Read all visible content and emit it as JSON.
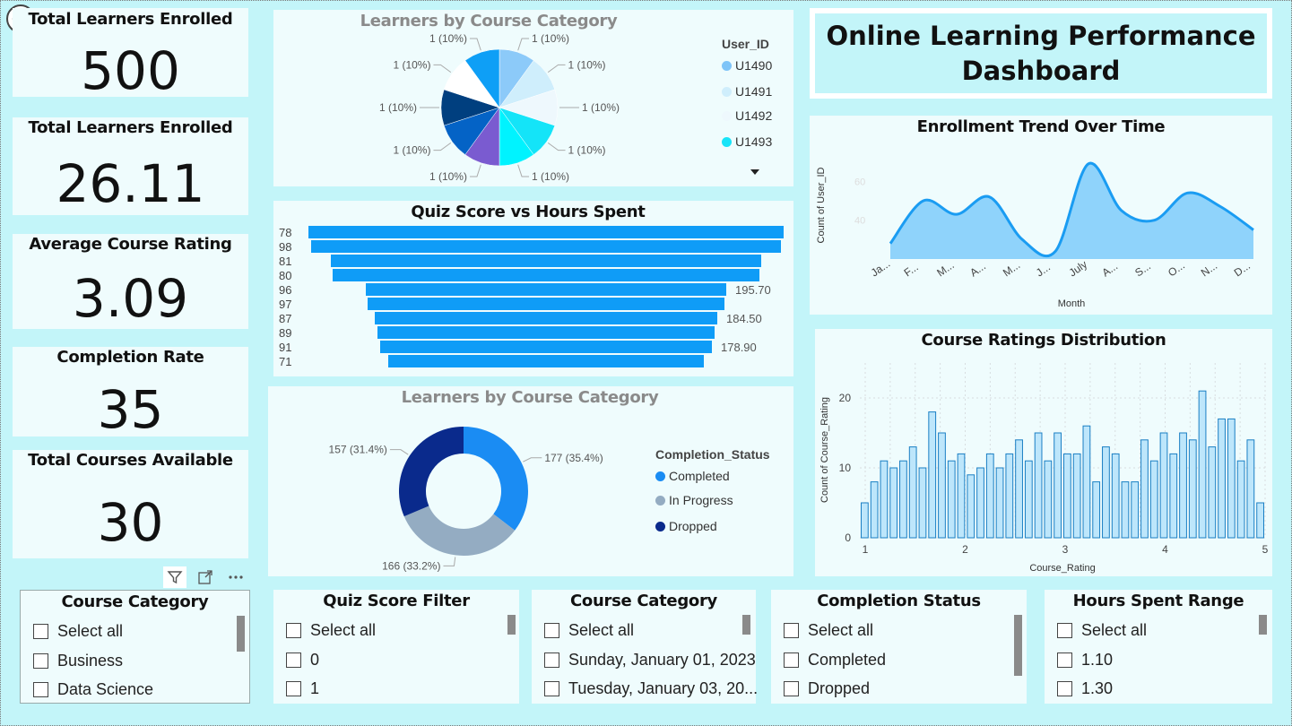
{
  "kpis": [
    {
      "title": "Total Learners Enrolled",
      "value": "500"
    },
    {
      "title": "Total Learners Enrolled",
      "value": "26.11"
    },
    {
      "title": "Average Course Rating",
      "value": "3.09"
    },
    {
      "title": "Completion Rate",
      "value": "35"
    },
    {
      "title": "Total Courses Available",
      "value": "30"
    }
  ],
  "dashboard_title": "Online Learning Performance Dashboard",
  "pie": {
    "title": "Learners by Course Category",
    "legend_title": "User_ID",
    "legend": [
      {
        "label": "U1490",
        "color": "#7ec4f8"
      },
      {
        "label": "U1491",
        "color": "#cfeefc"
      },
      {
        "label": "U1492",
        "color": "#eef8fd"
      },
      {
        "label": "U1493",
        "color": "#18e4f8"
      }
    ],
    "slice_label": "1 (10%)"
  },
  "funnel": {
    "title": "Quiz Score vs Hours Spent",
    "labels": [
      "195.70",
      "184.50",
      "178.90"
    ]
  },
  "donut": {
    "title": "Learners by Course Category",
    "legend_title": "Completion_Status",
    "legend": [
      {
        "label": "Completed",
        "color": "#1a8cf3"
      },
      {
        "label": "In Progress",
        "color": "#94acc2"
      },
      {
        "label": "Dropped",
        "color": "#0a2a8c"
      }
    ],
    "labels": [
      "177 (35.4%)",
      "166 (33.2%)",
      "157 (31.4%)"
    ]
  },
  "trend": {
    "title": "Enrollment Trend Over Time",
    "ylabel": "Count of User_ID",
    "xlabel": "Month",
    "ticks": [
      "40",
      "60"
    ],
    "months": [
      "Ja...",
      "F...",
      "M...",
      "A...",
      "M...",
      "J...",
      "July",
      "A...",
      "S...",
      "O...",
      "N...",
      "D..."
    ]
  },
  "ratings": {
    "title": "Course Ratings Distribution",
    "ylabel": "Count of Course_Rating",
    "xlabel": "Course_Rating",
    "yticks": [
      "0",
      "10",
      "20"
    ],
    "xticks": [
      "1",
      "2",
      "3",
      "4",
      "5"
    ]
  },
  "slicers": [
    {
      "title": "Course Category",
      "items": [
        "Select all",
        "Business",
        "Data Science"
      ]
    },
    {
      "title": "Quiz Score Filter",
      "items": [
        "Select all",
        "0",
        "1"
      ]
    },
    {
      "title": "Course Category",
      "items": [
        "Select all",
        "Sunday, January 01, 2023",
        "Tuesday, January 03, 20..."
      ]
    },
    {
      "title": "Completion Status",
      "items": [
        "Select all",
        "Completed",
        "Dropped"
      ]
    },
    {
      "title": "Hours Spent Range",
      "items": [
        "Select all",
        "1.10",
        "1.30"
      ]
    }
  ],
  "chart_data": [
    {
      "type": "pie",
      "title": "Learners by Course Category",
      "legend_title": "User_ID",
      "categories": [
        "",
        "",
        "",
        "",
        "",
        "",
        "",
        "",
        "",
        ""
      ],
      "values": [
        1,
        1,
        1,
        1,
        1,
        1,
        1,
        1,
        1,
        1
      ],
      "colors": [
        "#8ccaf9",
        "#cfeefc",
        "#eef8fd",
        "#14e4f8",
        "#00f3ff",
        "#7a5bd0",
        "#0463c6",
        "#003f7f",
        "#ffffff",
        "#0e9ff6"
      ],
      "labels": [
        "1 (10%)",
        "1 (10%)",
        "1 (10%)",
        "1 (10%)",
        "1 (10%)",
        "1 (10%)",
        "1 (10%)",
        "1 (10%)",
        "1 (10%)",
        "1 (10%)"
      ]
    },
    {
      "type": "bar",
      "orientation": "horizontal-funnel",
      "title": "Quiz Score vs Hours Spent",
      "categories": [
        "78",
        "98",
        "81",
        "80",
        "96",
        "97",
        "87",
        "89",
        "91",
        "71"
      ],
      "values": [
        265,
        262,
        240,
        238,
        201,
        199,
        191,
        188,
        185,
        176
      ],
      "color": "#0f9cf7"
    },
    {
      "type": "pie",
      "variant": "donut",
      "title": "Learners by Course Category",
      "legend_title": "Completion_Status",
      "categories": [
        "Completed",
        "In Progress",
        "Dropped"
      ],
      "values": [
        177,
        166,
        157
      ],
      "colors": [
        "#1a8cf3",
        "#94acc2",
        "#0a2a8c"
      ]
    },
    {
      "type": "area",
      "title": "Enrollment Trend Over Time",
      "xlabel": "Month",
      "ylabel": "Count of User_ID",
      "categories": [
        "Ja...",
        "F...",
        "M...",
        "A...",
        "M...",
        "J...",
        "July",
        "A...",
        "S...",
        "O...",
        "N...",
        "D..."
      ],
      "values": [
        28,
        50,
        43,
        52,
        30,
        24,
        69,
        45,
        40,
        54,
        47,
        35
      ],
      "ylim": [
        20,
        80
      ],
      "color": "#8fd3fb"
    },
    {
      "type": "bar",
      "title": "Course Ratings Distribution",
      "xlabel": "Course_Rating",
      "ylabel": "Count of Course_Rating",
      "x_range": [
        1,
        5
      ],
      "values": [
        5,
        8,
        11,
        10,
        11,
        13,
        10,
        18,
        15,
        11,
        12,
        9,
        10,
        12,
        10,
        12,
        14,
        11,
        15,
        11,
        15,
        12,
        12,
        16,
        8,
        13,
        12,
        8,
        8,
        14,
        11,
        15,
        12,
        15,
        14,
        21,
        13,
        17,
        17,
        11,
        14,
        5
      ],
      "ylim": [
        0,
        25
      ],
      "grid": true,
      "color": "#bde6fb"
    }
  ]
}
